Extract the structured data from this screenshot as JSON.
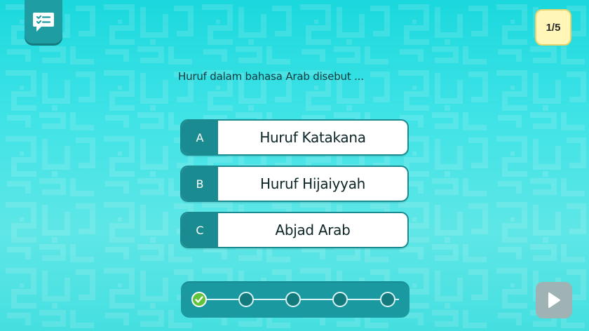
{
  "header": {
    "chat_icon": "chat-checklist-icon",
    "counter": "1/5"
  },
  "question": {
    "text": "Huruf dalam bahasa Arab disebut ..."
  },
  "options": [
    {
      "letter": "A",
      "text": "Huruf Katakana"
    },
    {
      "letter": "B",
      "text": "Huruf Hijaiyyah"
    },
    {
      "letter": "C",
      "text": "Abjad Arab"
    }
  ],
  "progress": {
    "total": 5,
    "completed": 1,
    "done_icon": "check-icon"
  },
  "next_button": {
    "icon": "play-arrow-icon"
  },
  "colors": {
    "background": "#2fe0e3",
    "accent": "#1a8c91",
    "counter_bg": "#fff6b8",
    "done": "#62c43c",
    "next_disabled": "#9fb3b4"
  }
}
